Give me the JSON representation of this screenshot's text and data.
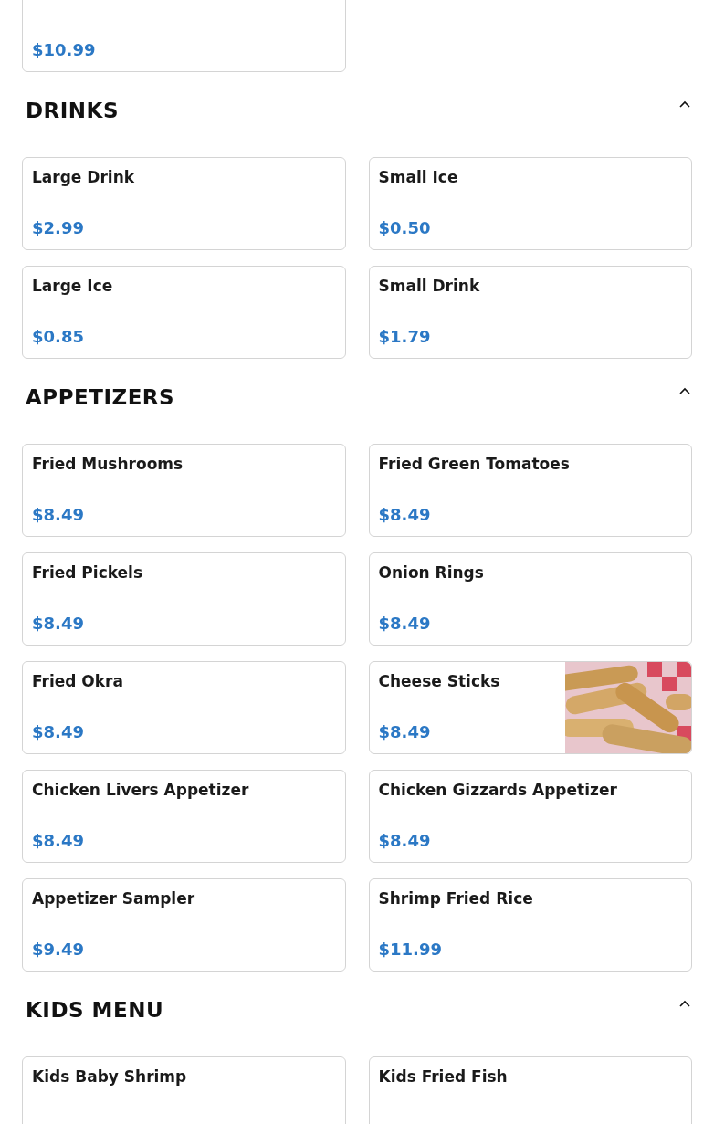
{
  "top_items": [
    {
      "price": "$10.99"
    }
  ],
  "sections": [
    {
      "title": "DRINKS",
      "expanded": true,
      "items": [
        {
          "name": "Large Drink",
          "price": "$2.99"
        },
        {
          "name": "Small Ice",
          "price": "$0.50"
        },
        {
          "name": "Large Ice",
          "price": "$0.85"
        },
        {
          "name": "Small Drink",
          "price": "$1.79"
        }
      ]
    },
    {
      "title": "APPETIZERS",
      "expanded": true,
      "items": [
        {
          "name": "Fried Mushrooms",
          "price": "$8.49"
        },
        {
          "name": "Fried Green Tomatoes",
          "price": "$8.49"
        },
        {
          "name": "Fried Pickels",
          "price": "$8.49"
        },
        {
          "name": "Onion Rings",
          "price": "$8.49"
        },
        {
          "name": "Fried Okra",
          "price": "$8.49"
        },
        {
          "name": "Cheese Sticks",
          "price": "$8.49",
          "kind": "picture"
        },
        {
          "name": "Chicken Livers Appetizer",
          "price": "$8.49"
        },
        {
          "name": "Chicken Gizzards Appetizer",
          "price": "$8.49"
        },
        {
          "name": "Appetizer Sampler",
          "price": "$9.49"
        },
        {
          "name": "Shrimp Fried Rice",
          "price": "$11.99"
        }
      ]
    },
    {
      "title": "KIDS MENU",
      "expanded": true,
      "items": [
        {
          "name": "Kids Baby Shrimp"
        },
        {
          "name": "Kids Fried Fish"
        }
      ]
    }
  ]
}
